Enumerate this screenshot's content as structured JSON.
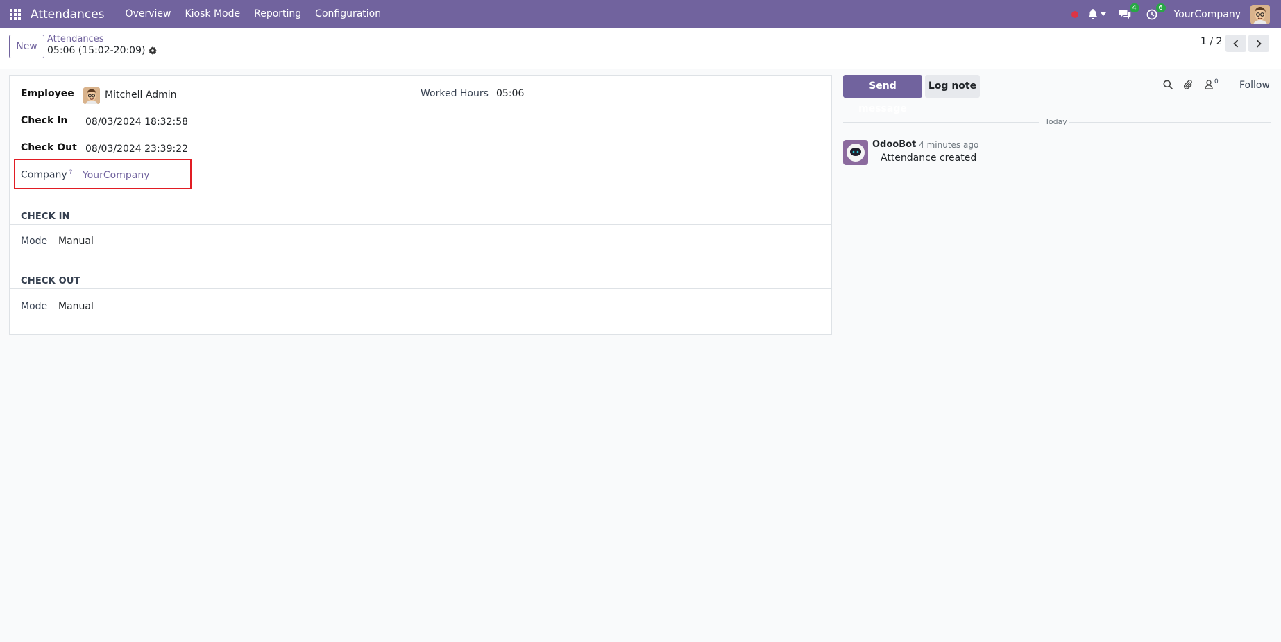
{
  "navbar": {
    "app_title": "Attendances",
    "menu": [
      "Overview",
      "Kiosk Mode",
      "Reporting",
      "Configuration"
    ],
    "messages_badge": "4",
    "activities_badge": "6",
    "company": "YourCompany"
  },
  "control_panel": {
    "new_label": "New",
    "breadcrumb_parent": "Attendances",
    "breadcrumb_current": "05:06 (15:02-20:09)",
    "pager_value": "1 / 2"
  },
  "form": {
    "employee_label": "Employee",
    "employee_value": "Mitchell Admin",
    "worked_hours_label": "Worked Hours",
    "worked_hours_value": "05:06",
    "check_in_label": "Check In",
    "check_in_value": "08/03/2024 18:32:58",
    "check_out_label": "Check Out",
    "check_out_value": "08/03/2024 23:39:22",
    "company_label": "Company",
    "company_help": "?",
    "company_value": "YourCompany",
    "section_check_in": "CHECK IN",
    "section_check_out": "CHECK OUT",
    "mode_label": "Mode",
    "check_in_mode": "Manual",
    "check_out_mode": "Manual"
  },
  "chatter": {
    "send_message": "Send message",
    "log_note": "Log note",
    "followers_count": "0",
    "follow": "Follow",
    "date_separator": "Today",
    "message": {
      "author": "OdooBot",
      "time": "- 4 minutes ago",
      "body": "Attendance created"
    }
  },
  "colors": {
    "brand": "#71639e",
    "highlight": "#e11d24",
    "badge": "#28a745"
  }
}
